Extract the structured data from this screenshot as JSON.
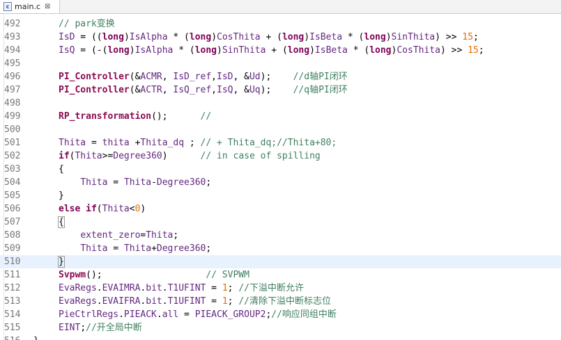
{
  "tab": {
    "file_icon_letter": "c",
    "title": "main.c",
    "close_glyph": "⊠"
  },
  "lines": [
    {
      "num": "492",
      "tokens": [
        {
          "c": "cm",
          "t": "// park变换"
        }
      ]
    },
    {
      "num": "493",
      "tokens": [
        {
          "c": "id",
          "t": "IsD"
        },
        {
          "c": "pl",
          "t": " = (("
        },
        {
          "c": "kw",
          "t": "long"
        },
        {
          "c": "pl",
          "t": ")"
        },
        {
          "c": "id",
          "t": "IsAlpha"
        },
        {
          "c": "pl",
          "t": " * ("
        },
        {
          "c": "kw",
          "t": "long"
        },
        {
          "c": "pl",
          "t": ")"
        },
        {
          "c": "id",
          "t": "CosThita"
        },
        {
          "c": "pl",
          "t": " + ("
        },
        {
          "c": "kw",
          "t": "long"
        },
        {
          "c": "pl",
          "t": ")"
        },
        {
          "c": "id",
          "t": "IsBeta"
        },
        {
          "c": "pl",
          "t": " * ("
        },
        {
          "c": "kw",
          "t": "long"
        },
        {
          "c": "pl",
          "t": ")"
        },
        {
          "c": "id",
          "t": "SinThita"
        },
        {
          "c": "pl",
          "t": ") >> "
        },
        {
          "c": "num",
          "t": "15"
        },
        {
          "c": "pl",
          "t": ";"
        }
      ]
    },
    {
      "num": "494",
      "tokens": [
        {
          "c": "id",
          "t": "IsQ"
        },
        {
          "c": "pl",
          "t": " = (-("
        },
        {
          "c": "kw",
          "t": "long"
        },
        {
          "c": "pl",
          "t": ")"
        },
        {
          "c": "id",
          "t": "IsAlpha"
        },
        {
          "c": "pl",
          "t": " * ("
        },
        {
          "c": "kw",
          "t": "long"
        },
        {
          "c": "pl",
          "t": ")"
        },
        {
          "c": "id",
          "t": "SinThita"
        },
        {
          "c": "pl",
          "t": " + ("
        },
        {
          "c": "kw",
          "t": "long"
        },
        {
          "c": "pl",
          "t": ")"
        },
        {
          "c": "id",
          "t": "IsBeta"
        },
        {
          "c": "pl",
          "t": " * ("
        },
        {
          "c": "kw",
          "t": "long"
        },
        {
          "c": "pl",
          "t": ")"
        },
        {
          "c": "id",
          "t": "CosThita"
        },
        {
          "c": "pl",
          "t": ") >> "
        },
        {
          "c": "num",
          "t": "15"
        },
        {
          "c": "pl",
          "t": ";"
        }
      ]
    },
    {
      "num": "495",
      "tokens": []
    },
    {
      "num": "496",
      "tokens": [
        {
          "c": "fn",
          "t": "PI_Controller"
        },
        {
          "c": "pl",
          "t": "(&"
        },
        {
          "c": "id",
          "t": "ACMR"
        },
        {
          "c": "pl",
          "t": ", "
        },
        {
          "c": "id",
          "t": "IsD_ref"
        },
        {
          "c": "pl",
          "t": ","
        },
        {
          "c": "id",
          "t": "IsD"
        },
        {
          "c": "pl",
          "t": ", &"
        },
        {
          "c": "id",
          "t": "Ud"
        },
        {
          "c": "pl",
          "t": ");    "
        },
        {
          "c": "cm",
          "t": "//d轴PI闭环"
        }
      ]
    },
    {
      "num": "497",
      "tokens": [
        {
          "c": "fn",
          "t": "PI_Controller"
        },
        {
          "c": "pl",
          "t": "(&"
        },
        {
          "c": "id",
          "t": "ACTR"
        },
        {
          "c": "pl",
          "t": ", "
        },
        {
          "c": "id",
          "t": "IsQ_ref"
        },
        {
          "c": "pl",
          "t": ","
        },
        {
          "c": "id",
          "t": "IsQ"
        },
        {
          "c": "pl",
          "t": ", &"
        },
        {
          "c": "id",
          "t": "Uq"
        },
        {
          "c": "pl",
          "t": ");    "
        },
        {
          "c": "cm",
          "t": "//q轴PI闭环"
        }
      ]
    },
    {
      "num": "498",
      "tokens": []
    },
    {
      "num": "499",
      "tokens": [
        {
          "c": "fn",
          "t": "RP_transformation"
        },
        {
          "c": "pl",
          "t": "();      "
        },
        {
          "c": "cm",
          "t": "//"
        }
      ]
    },
    {
      "num": "500",
      "tokens": []
    },
    {
      "num": "501",
      "tokens": [
        {
          "c": "id",
          "t": "Thita"
        },
        {
          "c": "pl",
          "t": " = "
        },
        {
          "c": "id",
          "t": "thita"
        },
        {
          "c": "pl",
          "t": " +"
        },
        {
          "c": "id",
          "t": "Thita_dq"
        },
        {
          "c": "pl",
          "t": " ; "
        },
        {
          "c": "cm",
          "t": "// + Thita_dq;//Thita+80;"
        }
      ]
    },
    {
      "num": "502",
      "tokens": [
        {
          "c": "kw",
          "t": "if"
        },
        {
          "c": "pl",
          "t": "("
        },
        {
          "c": "id",
          "t": "Thita"
        },
        {
          "c": "pl",
          "t": ">="
        },
        {
          "c": "id",
          "t": "Degree360"
        },
        {
          "c": "pl",
          "t": ")      "
        },
        {
          "c": "cm",
          "t": "// in case of spilling"
        }
      ]
    },
    {
      "num": "503",
      "tokens": [
        {
          "c": "pl",
          "t": "{"
        }
      ]
    },
    {
      "num": "504",
      "tokens": [
        {
          "c": "pl",
          "t": "    "
        },
        {
          "c": "id",
          "t": "Thita"
        },
        {
          "c": "pl",
          "t": " = "
        },
        {
          "c": "id",
          "t": "Thita"
        },
        {
          "c": "pl",
          "t": "-"
        },
        {
          "c": "id",
          "t": "Degree360"
        },
        {
          "c": "pl",
          "t": ";"
        }
      ]
    },
    {
      "num": "505",
      "tokens": [
        {
          "c": "pl",
          "t": "}"
        }
      ]
    },
    {
      "num": "506",
      "tokens": [
        {
          "c": "kw",
          "t": "else"
        },
        {
          "c": "pl",
          "t": " "
        },
        {
          "c": "kw",
          "t": "if"
        },
        {
          "c": "pl",
          "t": "("
        },
        {
          "c": "id",
          "t": "Thita"
        },
        {
          "c": "pl",
          "t": "<"
        },
        {
          "c": "num",
          "t": "0"
        },
        {
          "c": "pl",
          "t": ")"
        }
      ]
    },
    {
      "num": "507",
      "tokens": [
        {
          "c": "pl box",
          "t": "{"
        }
      ]
    },
    {
      "num": "508",
      "tokens": [
        {
          "c": "pl",
          "t": "    "
        },
        {
          "c": "id",
          "t": "extent_zero"
        },
        {
          "c": "pl",
          "t": "="
        },
        {
          "c": "id",
          "t": "Thita"
        },
        {
          "c": "pl",
          "t": ";"
        }
      ]
    },
    {
      "num": "509",
      "tokens": [
        {
          "c": "pl",
          "t": "    "
        },
        {
          "c": "id",
          "t": "Thita"
        },
        {
          "c": "pl",
          "t": " = "
        },
        {
          "c": "id",
          "t": "Thita"
        },
        {
          "c": "pl",
          "t": "+"
        },
        {
          "c": "id",
          "t": "Degree360"
        },
        {
          "c": "pl",
          "t": ";"
        }
      ]
    },
    {
      "num": "510",
      "current": true,
      "tokens": [
        {
          "c": "pl box",
          "t": "}"
        },
        {
          "c": "caret",
          "t": ""
        }
      ]
    },
    {
      "num": "511",
      "tokens": [
        {
          "c": "fn",
          "t": "Svpwm"
        },
        {
          "c": "pl",
          "t": "();                   "
        },
        {
          "c": "cm",
          "t": "// SVPWM"
        }
      ]
    },
    {
      "num": "512",
      "tokens": [
        {
          "c": "id",
          "t": "EvaRegs"
        },
        {
          "c": "pl",
          "t": "."
        },
        {
          "c": "id",
          "t": "EVAIMRA"
        },
        {
          "c": "pl",
          "t": "."
        },
        {
          "c": "id",
          "t": "bit"
        },
        {
          "c": "pl",
          "t": "."
        },
        {
          "c": "id",
          "t": "T1UFINT"
        },
        {
          "c": "pl",
          "t": " = "
        },
        {
          "c": "num",
          "t": "1"
        },
        {
          "c": "pl",
          "t": "; "
        },
        {
          "c": "cm",
          "t": "//下溢中断允许"
        }
      ]
    },
    {
      "num": "513",
      "tokens": [
        {
          "c": "id",
          "t": "EvaRegs"
        },
        {
          "c": "pl",
          "t": "."
        },
        {
          "c": "id",
          "t": "EVAIFRA"
        },
        {
          "c": "pl",
          "t": "."
        },
        {
          "c": "id",
          "t": "bit"
        },
        {
          "c": "pl",
          "t": "."
        },
        {
          "c": "id",
          "t": "T1UFINT"
        },
        {
          "c": "pl",
          "t": " = "
        },
        {
          "c": "num",
          "t": "1"
        },
        {
          "c": "pl",
          "t": "; "
        },
        {
          "c": "cm",
          "t": "//清除下溢中断标志位"
        }
      ]
    },
    {
      "num": "514",
      "tokens": [
        {
          "c": "id",
          "t": "PieCtrlRegs"
        },
        {
          "c": "pl",
          "t": "."
        },
        {
          "c": "id",
          "t": "PIEACK"
        },
        {
          "c": "pl",
          "t": "."
        },
        {
          "c": "id",
          "t": "all"
        },
        {
          "c": "pl",
          "t": " = "
        },
        {
          "c": "id",
          "t": "PIEACK_GROUP2"
        },
        {
          "c": "pl",
          "t": ";"
        },
        {
          "c": "cm",
          "t": "//响应同组中断"
        }
      ]
    },
    {
      "num": "515",
      "tokens": [
        {
          "c": "id",
          "t": "EINT"
        },
        {
          "c": "pl",
          "t": ";"
        },
        {
          "c": "cm",
          "t": "//开全局中断"
        }
      ]
    },
    {
      "num": "516",
      "tokens": [
        {
          "c": "pl",
          "t": "}"
        }
      ]
    }
  ]
}
